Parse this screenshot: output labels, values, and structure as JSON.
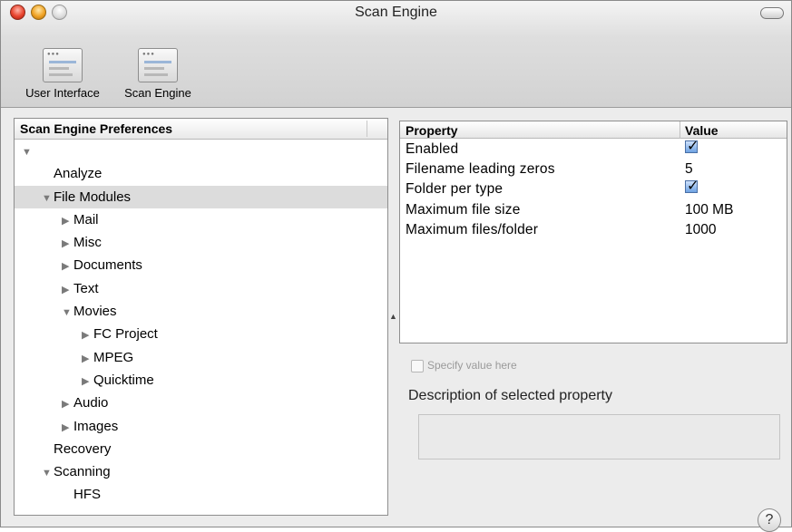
{
  "window": {
    "title": "Scan Engine"
  },
  "toolbar": {
    "items": [
      {
        "label": "User Interface",
        "icon": "preferences-window-icon"
      },
      {
        "label": "Scan Engine",
        "icon": "preferences-window-icon"
      }
    ]
  },
  "outline": {
    "header": "Scan Engine Preferences",
    "rows": [
      {
        "label": "",
        "indent": 0,
        "triangle": "down",
        "selected": false
      },
      {
        "label": "Analyze",
        "indent": 1,
        "triangle": "none",
        "selected": false
      },
      {
        "label": "File Modules",
        "indent": 1,
        "triangle": "down",
        "selected": true
      },
      {
        "label": "Mail",
        "indent": 2,
        "triangle": "right",
        "selected": false
      },
      {
        "label": "Misc",
        "indent": 2,
        "triangle": "right",
        "selected": false
      },
      {
        "label": "Documents",
        "indent": 2,
        "triangle": "right",
        "selected": false
      },
      {
        "label": "Text",
        "indent": 2,
        "triangle": "right",
        "selected": false
      },
      {
        "label": "Movies",
        "indent": 2,
        "triangle": "down",
        "selected": false
      },
      {
        "label": "FC Project",
        "indent": 3,
        "triangle": "right",
        "selected": false
      },
      {
        "label": "MPEG",
        "indent": 3,
        "triangle": "right",
        "selected": false
      },
      {
        "label": "Quicktime",
        "indent": 3,
        "triangle": "right",
        "selected": false
      },
      {
        "label": "Audio",
        "indent": 2,
        "triangle": "right",
        "selected": false
      },
      {
        "label": "Images",
        "indent": 2,
        "triangle": "right",
        "selected": false
      },
      {
        "label": "Recovery",
        "indent": 1,
        "triangle": "none",
        "selected": false
      },
      {
        "label": "Scanning",
        "indent": 1,
        "triangle": "down",
        "selected": false
      },
      {
        "label": "HFS",
        "indent": 2,
        "triangle": "none",
        "selected": false
      }
    ]
  },
  "properties": {
    "columns": {
      "property": "Property",
      "value": "Value"
    },
    "rows": [
      {
        "property": "Enabled",
        "value": "",
        "checked": true
      },
      {
        "property": "Filename leading zeros",
        "value": "5",
        "checked": false
      },
      {
        "property": "Folder per type",
        "value": "",
        "checked": true
      },
      {
        "property": "Maximum file size",
        "value": "100 MB",
        "checked": false
      },
      {
        "property": "Maximum files/folder",
        "value": "1000",
        "checked": false
      }
    ]
  },
  "specify_label": "Specify value here",
  "description_title": "Description of selected property",
  "help_label": "?"
}
